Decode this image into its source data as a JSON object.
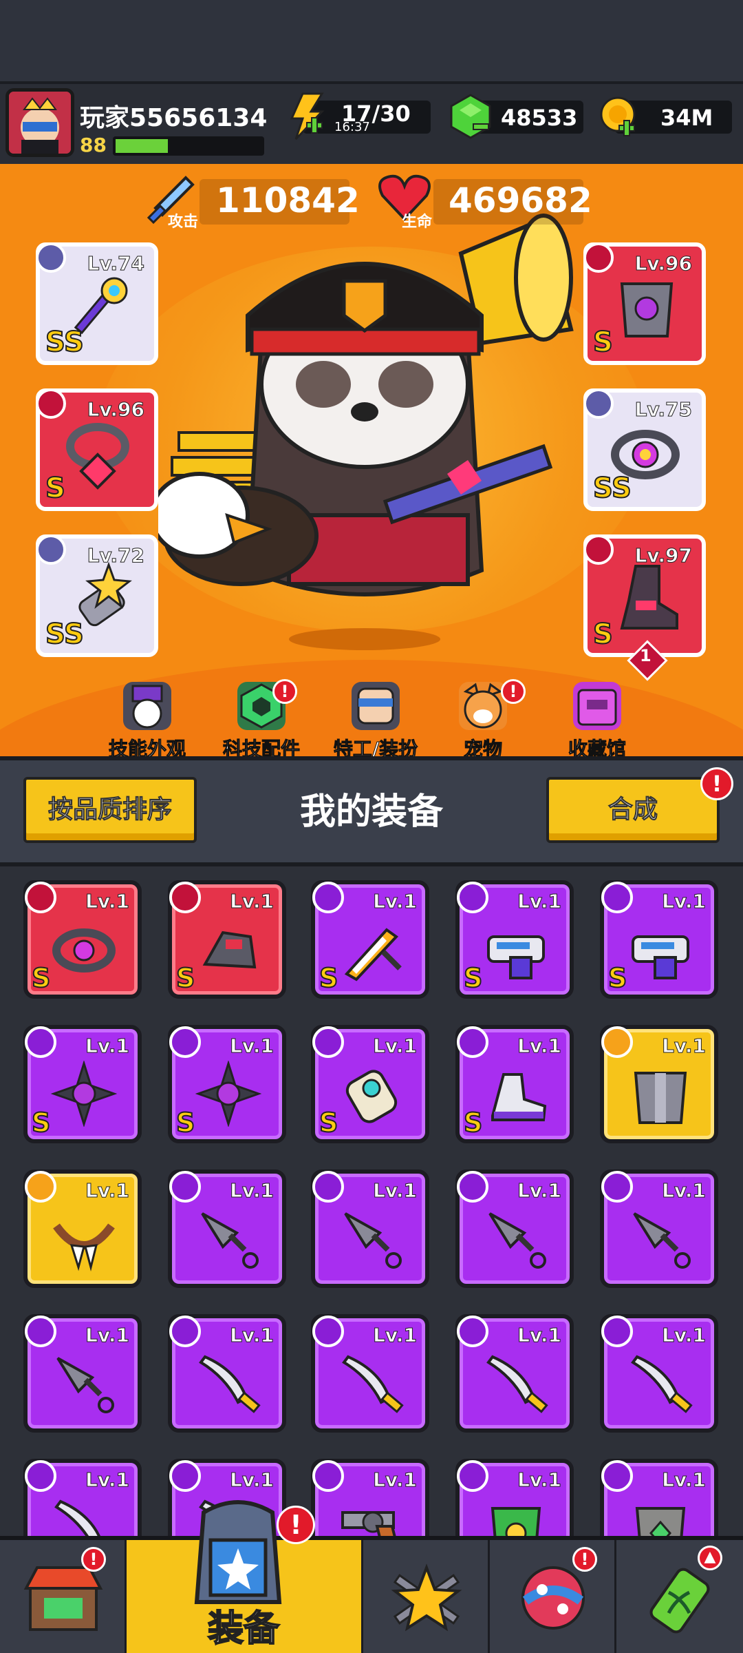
{
  "player": {
    "name": "玩家55656134",
    "level": "88",
    "xp_fraction": 0.36
  },
  "resources": {
    "energy": {
      "value": "17/30",
      "timer": "16:37",
      "icon": "lightning-icon"
    },
    "gems": {
      "value": "48533",
      "icon": "green-gem-icon"
    },
    "coins": {
      "value": "34M",
      "icon": "gold-coin-icon"
    }
  },
  "stats": {
    "attack": {
      "label": "攻击",
      "value": "110842"
    },
    "health": {
      "label": "生命",
      "value": "469682"
    }
  },
  "equipped": {
    "left": [
      {
        "level": "Lv.74",
        "rank": "SS",
        "slot_icon": "weapon-slot-icon"
      },
      {
        "level": "Lv.96",
        "rank": "S",
        "slot_icon": "necklace-slot-icon"
      },
      {
        "level": "Lv.72",
        "rank": "SS",
        "slot_icon": "glove-slot-icon"
      }
    ],
    "right": [
      {
        "level": "Lv.96",
        "rank": "S",
        "slot_icon": "armor-slot-icon"
      },
      {
        "level": "Lv.75",
        "rank": "SS",
        "slot_icon": "ring-slot-icon"
      },
      {
        "level": "Lv.97",
        "rank": "S",
        "slot_icon": "boot-slot-icon",
        "extra": "1"
      }
    ]
  },
  "hero_menu": [
    {
      "label": "技能外观",
      "icon": "skill-skin-icon",
      "alert": false
    },
    {
      "label": "科技配件",
      "icon": "tech-part-icon",
      "alert": true
    },
    {
      "label": "特工/装扮",
      "icon": "agent-costume-icon",
      "alert": false
    },
    {
      "label": "宠物",
      "icon": "pet-icon",
      "alert": true
    },
    {
      "label": "收藏馆",
      "icon": "collection-icon",
      "alert": false
    }
  ],
  "inventory_header": {
    "sort_label": "按品质排序",
    "title": "我的装备",
    "merge_label": "合成"
  },
  "inventory": [
    {
      "level": "Lv.1",
      "rarity": "red",
      "rank": "S",
      "badge": "ring-slot-icon",
      "art": "dark-ring-icon"
    },
    {
      "level": "Lv.1",
      "rarity": "red",
      "rank": "S",
      "badge": "glove-slot-icon",
      "art": "claw-gauntlet-icon"
    },
    {
      "level": "Lv.1",
      "rarity": "purple",
      "rank": "S",
      "badge": "weapon-slot-icon",
      "art": "flame-sword-icon"
    },
    {
      "level": "Lv.1",
      "rarity": "purple",
      "rank": "S",
      "badge": "weapon-slot-icon",
      "art": "blaster-gun-icon"
    },
    {
      "level": "Lv.1",
      "rarity": "purple",
      "rank": "S",
      "badge": "weapon-slot-icon",
      "art": "blaster-gun-icon"
    },
    {
      "level": "Lv.1",
      "rarity": "purple",
      "rank": "S",
      "badge": "weapon-slot-icon",
      "art": "spiked-orb-icon"
    },
    {
      "level": "Lv.1",
      "rarity": "purple",
      "rank": "S",
      "badge": "weapon-slot-icon",
      "art": "spiked-orb-icon"
    },
    {
      "level": "Lv.1",
      "rarity": "purple",
      "rank": "S",
      "badge": "glove-slot-icon",
      "art": "power-gauntlet-icon"
    },
    {
      "level": "Lv.1",
      "rarity": "purple",
      "rank": "S",
      "badge": "boot-slot-icon",
      "art": "sneaker-icon"
    },
    {
      "level": "Lv.1",
      "rarity": "gold",
      "rank": "",
      "badge": "armor-slot-icon",
      "art": "steel-armor-icon"
    },
    {
      "level": "Lv.1",
      "rarity": "gold",
      "rank": "",
      "badge": "necklace-slot-icon",
      "art": "fang-necklace-icon"
    },
    {
      "level": "Lv.1",
      "rarity": "purple",
      "rank": "",
      "badge": "weapon-slot-icon",
      "art": "kunai-icon"
    },
    {
      "level": "Lv.1",
      "rarity": "purple",
      "rank": "",
      "badge": "weapon-slot-icon",
      "art": "kunai-icon"
    },
    {
      "level": "Lv.1",
      "rarity": "purple",
      "rank": "",
      "badge": "weapon-slot-icon",
      "art": "kunai-icon"
    },
    {
      "level": "Lv.1",
      "rarity": "purple",
      "rank": "",
      "badge": "weapon-slot-icon",
      "art": "kunai-icon"
    },
    {
      "level": "Lv.1",
      "rarity": "purple",
      "rank": "",
      "badge": "weapon-slot-icon",
      "art": "kunai-icon"
    },
    {
      "level": "Lv.1",
      "rarity": "purple",
      "rank": "",
      "badge": "weapon-slot-icon",
      "art": "machete-icon"
    },
    {
      "level": "Lv.1",
      "rarity": "purple",
      "rank": "",
      "badge": "weapon-slot-icon",
      "art": "machete-icon"
    },
    {
      "level": "Lv.1",
      "rarity": "purple",
      "rank": "",
      "badge": "weapon-slot-icon",
      "art": "machete-icon"
    },
    {
      "level": "Lv.1",
      "rarity": "purple",
      "rank": "",
      "badge": "weapon-slot-icon",
      "art": "machete-icon"
    },
    {
      "level": "Lv.1",
      "rarity": "purple",
      "rank": "",
      "badge": "weapon-slot-icon",
      "art": "machete-icon"
    },
    {
      "level": "Lv.1",
      "rarity": "purple",
      "rank": "",
      "badge": "weapon-slot-icon",
      "art": "machete-icon"
    },
    {
      "level": "Lv.1",
      "rarity": "purple",
      "rank": "",
      "badge": "weapon-slot-icon",
      "art": "revolver-icon"
    },
    {
      "level": "Lv.1",
      "rarity": "purple",
      "rank": "",
      "badge": "armor-slot-icon",
      "art": "leaf-armor-icon"
    },
    {
      "level": "Lv.1",
      "rarity": "purple",
      "rank": "",
      "badge": "armor-slot-icon",
      "art": "stone-armor-icon"
    }
  ],
  "bottom_nav": [
    {
      "label": "",
      "icon": "shop-icon",
      "alert": true
    },
    {
      "label": "装备",
      "icon": "equipment-icon",
      "alert": true,
      "active": true
    },
    {
      "label": "",
      "icon": "star-swords-icon",
      "alert": false
    },
    {
      "label": "",
      "icon": "planet-icon",
      "alert": true
    },
    {
      "label": "",
      "icon": "dna-vial-icon",
      "alert": false,
      "upgrade": true
    }
  ],
  "colors": {
    "hero_bg": "#f58a12",
    "legendary_red": "#e5334a",
    "epic_purple": "#a82ef0",
    "gold": "#f6c41a",
    "panel_dark": "#2d3038"
  }
}
